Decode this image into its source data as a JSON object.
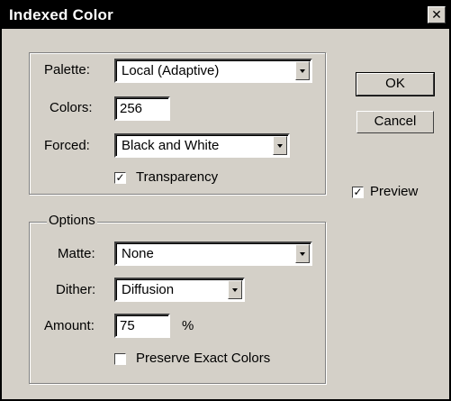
{
  "window": {
    "title": "Indexed Color",
    "close_glyph": "✕"
  },
  "palette_group": {
    "palette_label": "Palette:",
    "palette_value": "Local (Adaptive)",
    "colors_label": "Colors:",
    "colors_value": "256",
    "forced_label": "Forced:",
    "forced_value": "Black and White",
    "transparency_label": "Transparency",
    "transparency_checked": true
  },
  "options_group": {
    "legend": "Options",
    "matte_label": "Matte:",
    "matte_value": "None",
    "dither_label": "Dither:",
    "dither_value": "Diffusion",
    "amount_label": "Amount:",
    "amount_value": "75",
    "amount_unit": "%",
    "preserve_label": "Preserve Exact Colors",
    "preserve_checked": false
  },
  "buttons": {
    "ok": "OK",
    "cancel": "Cancel"
  },
  "preview": {
    "label": "Preview",
    "checked": true
  },
  "check_glyph": "✓"
}
